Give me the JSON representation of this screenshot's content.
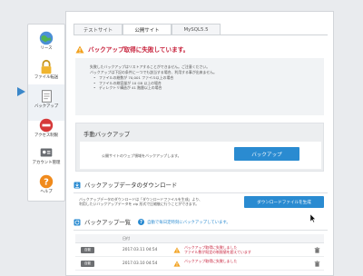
{
  "sidebar": {
    "items": [
      {
        "label": "リース",
        "icon": "globe-icon"
      },
      {
        "label": "ファイル転送",
        "icon": "lock-icon"
      },
      {
        "label": "バックアップ",
        "icon": "backup-icon"
      },
      {
        "label": "アクセス制限",
        "icon": "no-entry-icon"
      },
      {
        "label": "アカウント管理",
        "icon": "id-card-icon"
      },
      {
        "label": "ヘルプ",
        "icon": "help-icon"
      }
    ],
    "active_index": 2
  },
  "tabs": [
    {
      "label": "テストサイト"
    },
    {
      "label": "公開サイト"
    },
    {
      "label": "MySQL5.5"
    }
  ],
  "active_tab": 1,
  "error_title": "バックアップ取得に失敗しています。",
  "info": {
    "line1": "失敗したバックアップはリストアすることができません。ご注意ください。",
    "line2": "バックアップは下記の条件に一つでも該当する場合、利用する事が出来ません。",
    "bullets": [
      "ファイルの総数が 70,001 ファイル以上の場合",
      "ファイルの総容量が 10 GB 以上の場合",
      "ディレクトリ構造が 41 階層以上の場合"
    ]
  },
  "manual_backup": {
    "title": "手動バックアップ",
    "description": "公開サイトのウェブ領域をバックアップします。",
    "button": "バックアップ"
  },
  "download": {
    "title": "バックアップデータのダウンロード",
    "text1": "バックアップデータのダウンロードは「ダウンロードファイルを生成」より、",
    "text2": "利用したいバックアップデータを zip 形式で圧縮後に行うことができます。",
    "button": "ダウンロードファイルを生成"
  },
  "backup_list": {
    "title": "バックアップ一覧",
    "help_text": "自動で毎日定時刻にバックアップしています。",
    "column_date": "日付",
    "rows": [
      {
        "badge": "自動",
        "date": "2017.03.11 04:54",
        "message_1": "バックアップ取得に失敗しました",
        "message_2": "ファイル数が既定の制限値を超えています"
      },
      {
        "badge": "自動",
        "date": "2017.03.10 04:54",
        "message_1": "バックアップ取得に失敗しました",
        "message_2": ""
      }
    ]
  },
  "colors": {
    "accent": "#2a8bd1",
    "error": "#c7213b",
    "badge": "#6d6f72"
  }
}
